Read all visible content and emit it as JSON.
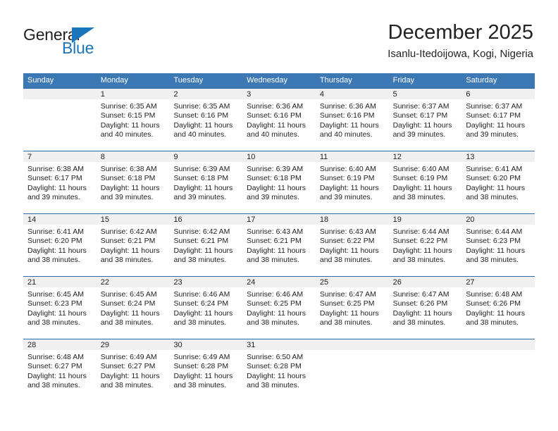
{
  "brand": {
    "name_part1": "General",
    "name_part2": "Blue",
    "color_dark": "#231f20",
    "color_blue": "#1b75bb"
  },
  "header": {
    "title": "December 2025",
    "subtitle": "Isanlu-Itedoijowa, Kogi, Nigeria"
  },
  "theme": {
    "header_blue": "#3c78b4",
    "band_gray": "#f0f0f0",
    "text": "#222222"
  },
  "weekdays": [
    "Sunday",
    "Monday",
    "Tuesday",
    "Wednesday",
    "Thursday",
    "Friday",
    "Saturday"
  ],
  "weeks": [
    [
      {
        "day": "",
        "sunrise": "",
        "sunset": "",
        "daylight1": "",
        "daylight2": "",
        "empty": true
      },
      {
        "day": "1",
        "sunrise": "Sunrise: 6:35 AM",
        "sunset": "Sunset: 6:15 PM",
        "daylight1": "Daylight: 11 hours",
        "daylight2": "and 40 minutes."
      },
      {
        "day": "2",
        "sunrise": "Sunrise: 6:35 AM",
        "sunset": "Sunset: 6:16 PM",
        "daylight1": "Daylight: 11 hours",
        "daylight2": "and 40 minutes."
      },
      {
        "day": "3",
        "sunrise": "Sunrise: 6:36 AM",
        "sunset": "Sunset: 6:16 PM",
        "daylight1": "Daylight: 11 hours",
        "daylight2": "and 40 minutes."
      },
      {
        "day": "4",
        "sunrise": "Sunrise: 6:36 AM",
        "sunset": "Sunset: 6:16 PM",
        "daylight1": "Daylight: 11 hours",
        "daylight2": "and 40 minutes."
      },
      {
        "day": "5",
        "sunrise": "Sunrise: 6:37 AM",
        "sunset": "Sunset: 6:17 PM",
        "daylight1": "Daylight: 11 hours",
        "daylight2": "and 39 minutes."
      },
      {
        "day": "6",
        "sunrise": "Sunrise: 6:37 AM",
        "sunset": "Sunset: 6:17 PM",
        "daylight1": "Daylight: 11 hours",
        "daylight2": "and 39 minutes."
      }
    ],
    [
      {
        "day": "7",
        "sunrise": "Sunrise: 6:38 AM",
        "sunset": "Sunset: 6:17 PM",
        "daylight1": "Daylight: 11 hours",
        "daylight2": "and 39 minutes."
      },
      {
        "day": "8",
        "sunrise": "Sunrise: 6:38 AM",
        "sunset": "Sunset: 6:18 PM",
        "daylight1": "Daylight: 11 hours",
        "daylight2": "and 39 minutes."
      },
      {
        "day": "9",
        "sunrise": "Sunrise: 6:39 AM",
        "sunset": "Sunset: 6:18 PM",
        "daylight1": "Daylight: 11 hours",
        "daylight2": "and 39 minutes."
      },
      {
        "day": "10",
        "sunrise": "Sunrise: 6:39 AM",
        "sunset": "Sunset: 6:18 PM",
        "daylight1": "Daylight: 11 hours",
        "daylight2": "and 39 minutes."
      },
      {
        "day": "11",
        "sunrise": "Sunrise: 6:40 AM",
        "sunset": "Sunset: 6:19 PM",
        "daylight1": "Daylight: 11 hours",
        "daylight2": "and 39 minutes."
      },
      {
        "day": "12",
        "sunrise": "Sunrise: 6:40 AM",
        "sunset": "Sunset: 6:19 PM",
        "daylight1": "Daylight: 11 hours",
        "daylight2": "and 38 minutes."
      },
      {
        "day": "13",
        "sunrise": "Sunrise: 6:41 AM",
        "sunset": "Sunset: 6:20 PM",
        "daylight1": "Daylight: 11 hours",
        "daylight2": "and 38 minutes."
      }
    ],
    [
      {
        "day": "14",
        "sunrise": "Sunrise: 6:41 AM",
        "sunset": "Sunset: 6:20 PM",
        "daylight1": "Daylight: 11 hours",
        "daylight2": "and 38 minutes."
      },
      {
        "day": "15",
        "sunrise": "Sunrise: 6:42 AM",
        "sunset": "Sunset: 6:21 PM",
        "daylight1": "Daylight: 11 hours",
        "daylight2": "and 38 minutes."
      },
      {
        "day": "16",
        "sunrise": "Sunrise: 6:42 AM",
        "sunset": "Sunset: 6:21 PM",
        "daylight1": "Daylight: 11 hours",
        "daylight2": "and 38 minutes."
      },
      {
        "day": "17",
        "sunrise": "Sunrise: 6:43 AM",
        "sunset": "Sunset: 6:21 PM",
        "daylight1": "Daylight: 11 hours",
        "daylight2": "and 38 minutes."
      },
      {
        "day": "18",
        "sunrise": "Sunrise: 6:43 AM",
        "sunset": "Sunset: 6:22 PM",
        "daylight1": "Daylight: 11 hours",
        "daylight2": "and 38 minutes."
      },
      {
        "day": "19",
        "sunrise": "Sunrise: 6:44 AM",
        "sunset": "Sunset: 6:22 PM",
        "daylight1": "Daylight: 11 hours",
        "daylight2": "and 38 minutes."
      },
      {
        "day": "20",
        "sunrise": "Sunrise: 6:44 AM",
        "sunset": "Sunset: 6:23 PM",
        "daylight1": "Daylight: 11 hours",
        "daylight2": "and 38 minutes."
      }
    ],
    [
      {
        "day": "21",
        "sunrise": "Sunrise: 6:45 AM",
        "sunset": "Sunset: 6:23 PM",
        "daylight1": "Daylight: 11 hours",
        "daylight2": "and 38 minutes."
      },
      {
        "day": "22",
        "sunrise": "Sunrise: 6:45 AM",
        "sunset": "Sunset: 6:24 PM",
        "daylight1": "Daylight: 11 hours",
        "daylight2": "and 38 minutes."
      },
      {
        "day": "23",
        "sunrise": "Sunrise: 6:46 AM",
        "sunset": "Sunset: 6:24 PM",
        "daylight1": "Daylight: 11 hours",
        "daylight2": "and 38 minutes."
      },
      {
        "day": "24",
        "sunrise": "Sunrise: 6:46 AM",
        "sunset": "Sunset: 6:25 PM",
        "daylight1": "Daylight: 11 hours",
        "daylight2": "and 38 minutes."
      },
      {
        "day": "25",
        "sunrise": "Sunrise: 6:47 AM",
        "sunset": "Sunset: 6:25 PM",
        "daylight1": "Daylight: 11 hours",
        "daylight2": "and 38 minutes."
      },
      {
        "day": "26",
        "sunrise": "Sunrise: 6:47 AM",
        "sunset": "Sunset: 6:26 PM",
        "daylight1": "Daylight: 11 hours",
        "daylight2": "and 38 minutes."
      },
      {
        "day": "27",
        "sunrise": "Sunrise: 6:48 AM",
        "sunset": "Sunset: 6:26 PM",
        "daylight1": "Daylight: 11 hours",
        "daylight2": "and 38 minutes."
      }
    ],
    [
      {
        "day": "28",
        "sunrise": "Sunrise: 6:48 AM",
        "sunset": "Sunset: 6:27 PM",
        "daylight1": "Daylight: 11 hours",
        "daylight2": "and 38 minutes."
      },
      {
        "day": "29",
        "sunrise": "Sunrise: 6:49 AM",
        "sunset": "Sunset: 6:27 PM",
        "daylight1": "Daylight: 11 hours",
        "daylight2": "and 38 minutes."
      },
      {
        "day": "30",
        "sunrise": "Sunrise: 6:49 AM",
        "sunset": "Sunset: 6:28 PM",
        "daylight1": "Daylight: 11 hours",
        "daylight2": "and 38 minutes."
      },
      {
        "day": "31",
        "sunrise": "Sunrise: 6:50 AM",
        "sunset": "Sunset: 6:28 PM",
        "daylight1": "Daylight: 11 hours",
        "daylight2": "and 38 minutes."
      },
      {
        "day": "",
        "sunrise": "",
        "sunset": "",
        "daylight1": "",
        "daylight2": "",
        "empty": true
      },
      {
        "day": "",
        "sunrise": "",
        "sunset": "",
        "daylight1": "",
        "daylight2": "",
        "empty": true
      },
      {
        "day": "",
        "sunrise": "",
        "sunset": "",
        "daylight1": "",
        "daylight2": "",
        "empty": true
      }
    ]
  ]
}
